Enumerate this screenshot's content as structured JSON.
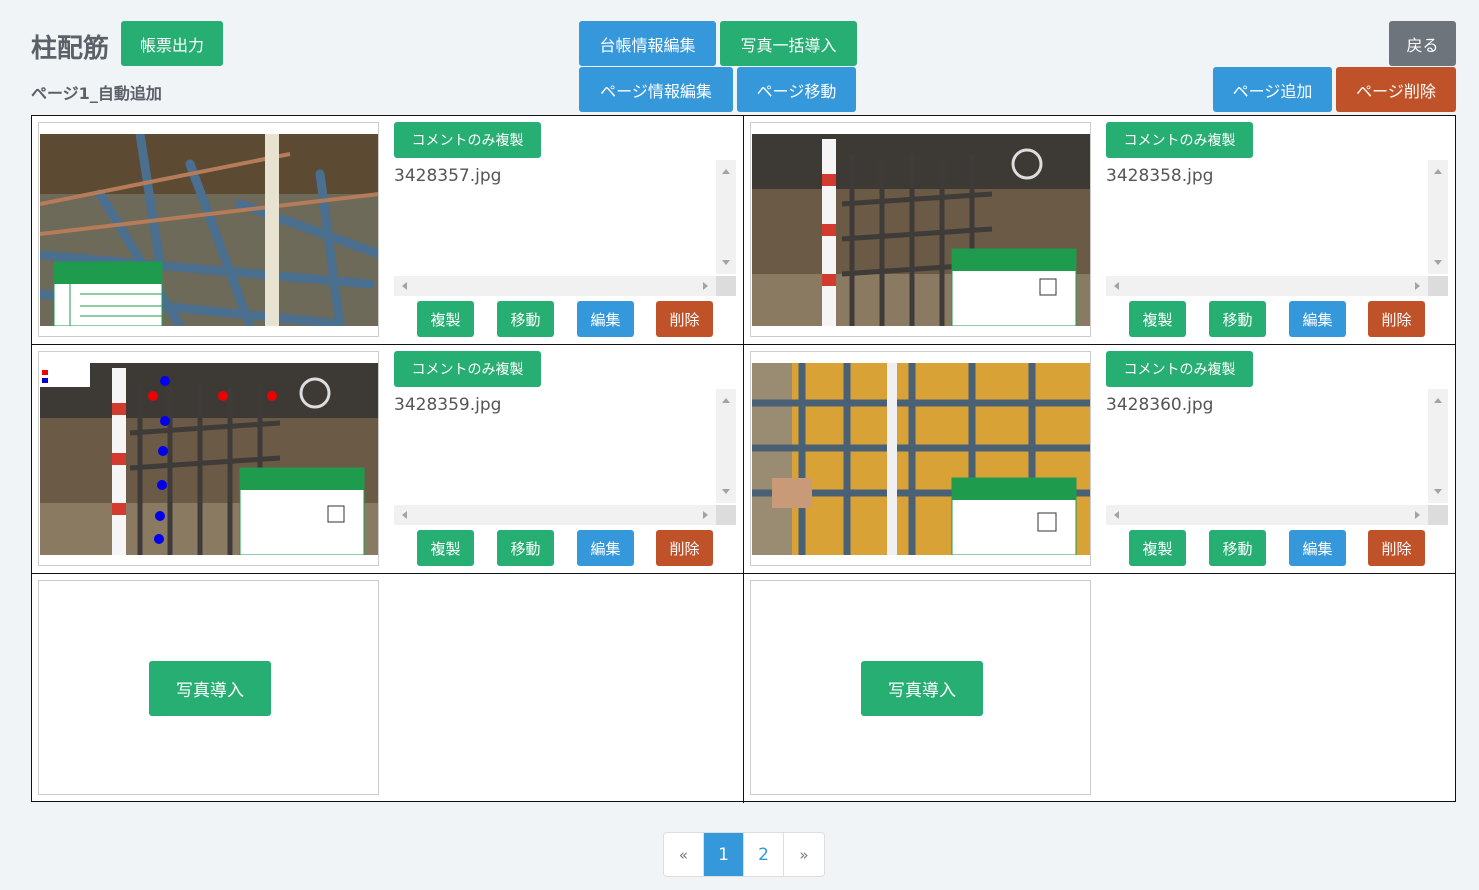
{
  "header": {
    "title": "柱配筋",
    "subtitle": "ページ1_自動追加",
    "report_output": "帳票出力",
    "ledger_edit": "台帳情報編集",
    "bulk_import": "写真一括導入",
    "page_info_edit": "ページ情報編集",
    "page_move": "ページ移動",
    "back": "戻る",
    "page_add": "ページ追加",
    "page_delete": "ページ削除"
  },
  "cells": [
    {
      "filename": "3428357.jpg"
    },
    {
      "filename": "3428358.jpg"
    },
    {
      "filename": "3428359.jpg"
    },
    {
      "filename": "3428360.jpg"
    }
  ],
  "cell_labels": {
    "copy_comment": "コメントのみ複製",
    "duplicate": "複製",
    "move": "移動",
    "edit": "編集",
    "delete": "削除",
    "photo_import": "写真導入"
  },
  "pager": {
    "prev": "«",
    "pages": [
      "1",
      "2"
    ],
    "current": "1",
    "next": "»"
  },
  "colors": {
    "green": "#27ae73",
    "blue": "#3498db",
    "red": "#c0522a",
    "gray": "#6d747c"
  }
}
